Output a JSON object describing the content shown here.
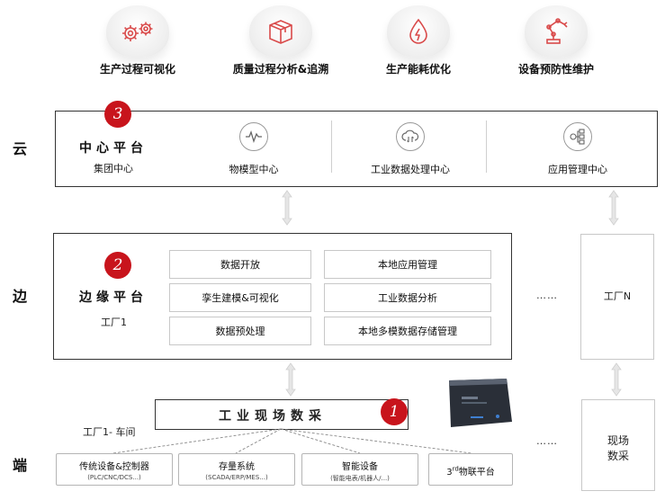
{
  "applications": [
    {
      "label": "生产过程可视化",
      "icon": "gears-icon"
    },
    {
      "label": "质量过程分析&追溯",
      "icon": "box-icon"
    },
    {
      "label": "生产能耗优化",
      "icon": "energy-drop-icon"
    },
    {
      "label": "设备预防性维护",
      "icon": "robot-arm-icon"
    }
  ],
  "layers": {
    "cloud": "云",
    "edge": "边",
    "end": "端"
  },
  "cloud": {
    "badge": "3",
    "title": "中心平台",
    "subtitle": "集团中心",
    "items": [
      {
        "label": "物模型中心",
        "icon": "waveform-icon"
      },
      {
        "label": "工业数据处理中心",
        "icon": "cloud-sync-icon"
      },
      {
        "label": "应用管理中心",
        "icon": "app-tree-icon"
      }
    ]
  },
  "edge": {
    "badge": "2",
    "title": "边缘平台",
    "subtitle": "工厂1",
    "cells": [
      "数据开放",
      "本地应用管理",
      "孪生建模&可视化",
      "工业数据分析",
      "数据预处理",
      "本地多模数据存储管理"
    ]
  },
  "edge_dots": "……",
  "factory_n": "工厂N",
  "acquisition": {
    "badge": "1",
    "title": "工业现场数采",
    "workshop": "工厂1- 车间"
  },
  "gateway_text": {
    "line1": "现场数采",
    "line2": ""
  },
  "field_box": {
    "line1": "现场",
    "line2": "数采"
  },
  "end_dots": "……",
  "devices": [
    {
      "main": "传统设备&控制器",
      "sub": "(PLC/CNC/DCS...)"
    },
    {
      "main": "存量系统",
      "sub": "(SCADA/ERP/MES...)"
    },
    {
      "main": "智能设备",
      "sub": "(智能电表/机器人/...)"
    },
    {
      "main_prefix": "3",
      "main_sup": "rd",
      "main_suffix": "物联平台",
      "sub": ""
    }
  ],
  "colors": {
    "accent": "#c8141c",
    "border": "#333333",
    "light_border": "#c8c8c8"
  }
}
